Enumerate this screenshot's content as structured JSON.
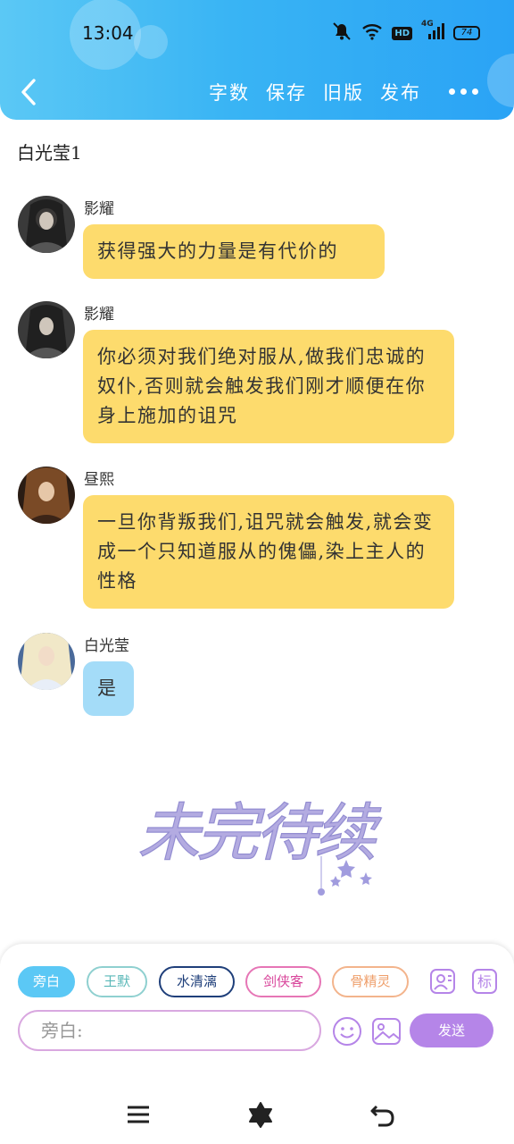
{
  "status_bar": {
    "time": "13:04",
    "battery": "74",
    "network": "4G",
    "hd": "HD"
  },
  "toolbar": {
    "back_icon": "chevron-left-icon",
    "actions": [
      "字数",
      "保存",
      "旧版",
      "发布"
    ],
    "more_icon": "more-horizontal-icon"
  },
  "chat": {
    "title": "白光莹1",
    "messages": [
      {
        "sender": "影耀",
        "text": "获得强大的力量是有代价的",
        "bubble_color": "#fddb6d"
      },
      {
        "sender": "影耀",
        "text": "你必须对我们绝对服从,做我们忠诚的奴仆,否则就会触发我们刚才顺便在你身上施加的诅咒",
        "bubble_color": "#fddb6d"
      },
      {
        "sender": "昼熙",
        "text": "一旦你背叛我们,诅咒就会触发,就会变成一个只知道服从的傀儡,染上主人的性格",
        "bubble_color": "#fddb6d"
      },
      {
        "sender": "白光莹",
        "text": "是",
        "bubble_color": "#a4dcf8"
      }
    ],
    "watermark_text": "未完待续"
  },
  "composer": {
    "roles": [
      {
        "label": "旁白",
        "color": "#5bc8f5",
        "active": true
      },
      {
        "label": "王默",
        "color": "#5ab8b8",
        "active": false
      },
      {
        "label": "水清漓",
        "color": "#1f3f7a",
        "active": false
      },
      {
        "label": "剑侠客",
        "color": "#d8449a",
        "active": false
      },
      {
        "label": "骨精灵",
        "color": "#ef9f6b",
        "active": false
      }
    ],
    "role_icons": [
      "contact-icon",
      "tag-icon"
    ],
    "placeholder": "旁白:",
    "emoji_icon": "emoji-icon",
    "image_icon": "image-icon",
    "send_label": "发送"
  },
  "nav": {
    "icons": [
      "menu-icon",
      "home-flower-icon",
      "back-arrow-icon"
    ]
  },
  "colors": {
    "header_start": "#5bc8f5",
    "header_end": "#2aa3f5",
    "accent_purple": "#b585e8"
  }
}
